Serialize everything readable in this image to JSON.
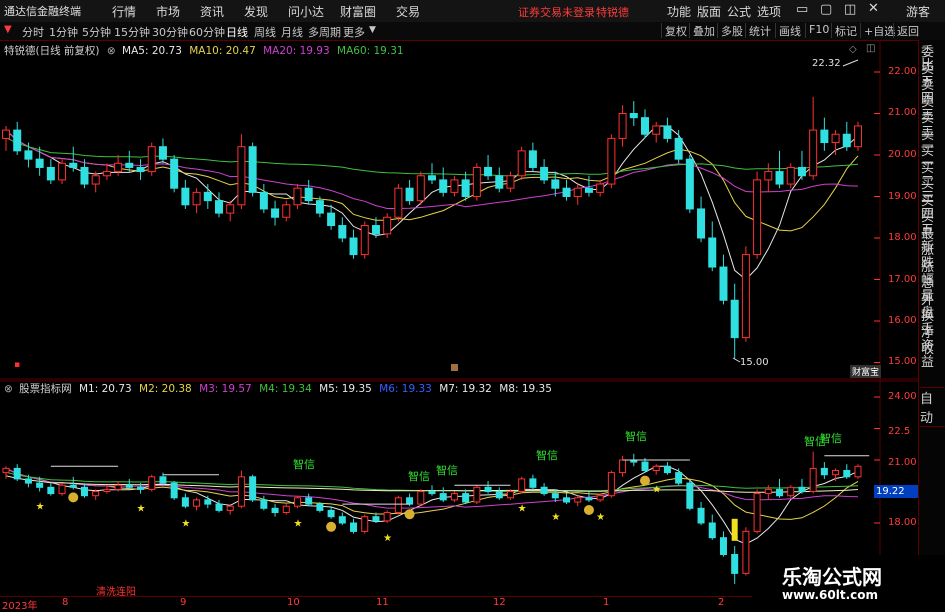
{
  "menubar": {
    "app_name": "通达信金融终端",
    "items": [
      "行情",
      "市场",
      "资讯",
      "发现",
      "问小达",
      "财富圈",
      "交易"
    ],
    "notice": "证券交易未登录",
    "stock_name": "特锐德",
    "right_items": [
      "功能",
      "版面",
      "公式",
      "选项"
    ],
    "user": "游客"
  },
  "toolbar": {
    "periods": [
      "分时",
      "1分钟",
      "5分钟",
      "15分钟",
      "30分钟",
      "60分钟",
      "日线",
      "周线",
      "月线",
      "多周期",
      "更多"
    ],
    "active_period": "日线",
    "buttons": [
      "复权",
      "叠加",
      "多股",
      "统计",
      "画线",
      "F10",
      "标记",
      "+自选",
      "返回"
    ]
  },
  "main_chart": {
    "header_name": "特锐德(日线 前复权)",
    "ma": [
      {
        "label": "MA5: 20.73",
        "color": "#e8e8e8"
      },
      {
        "label": "MA10: 20.47",
        "color": "#e6d34a"
      },
      {
        "label": "MA20: 19.93",
        "color": "#d040d0"
      },
      {
        "label": "MA60: 19.31",
        "color": "#40c040"
      }
    ],
    "y_ticks": [
      "22.00",
      "21.00",
      "20.00",
      "19.00",
      "18.00",
      "17.00",
      "16.00",
      "15.00"
    ],
    "high_label": "22.32",
    "low_label": "15.00",
    "corner_tag": "财富宝"
  },
  "indicator": {
    "name": "股票指标网",
    "lines": [
      {
        "label": "M1: 20.73",
        "color": "#e8e8e8"
      },
      {
        "label": "M2: 20.38",
        "color": "#e6d34a"
      },
      {
        "label": "M3: 19.57",
        "color": "#d040d0"
      },
      {
        "label": "M4: 19.34",
        "color": "#40c040"
      },
      {
        "label": "M5: 19.35",
        "color": "#e8e8e8"
      },
      {
        "label": "M6: 19.33",
        "color": "#3060ff"
      },
      {
        "label": "M7: 19.32",
        "color": "#e8e8e8"
      },
      {
        "label": "M8: 19.35",
        "color": "#e8e8e8"
      }
    ],
    "y_ticks": [
      "24.00",
      "22.5",
      "21.00",
      "19.22",
      "18.00"
    ],
    "current_value": "19.22",
    "signal_label": "智信",
    "bottom_note": "清洗连阳"
  },
  "time_axis": [
    "2023年",
    "8",
    "9",
    "10",
    "11",
    "12",
    "1",
    "2"
  ],
  "right_panel": [
    "委比",
    "卖五",
    "卖四",
    "卖三",
    "卖二",
    "卖一",
    "买一",
    "买二",
    "买三",
    "买四",
    "买五",
    "最新",
    "涨跌",
    "涨幅",
    "总量",
    "外盘",
    "换手",
    "净资",
    "收益"
  ],
  "right_panel_auto": "自动",
  "watermark": {
    "title": "乐淘公式网",
    "url": "www.60lt.com"
  },
  "colors": {
    "up": "#ff3030",
    "down": "#30e0e0",
    "grid": "#5a0000",
    "axis_text": "#ff3b3b"
  },
  "chart_data": {
    "type": "candlestick",
    "title": "特锐德(日线 前复权)",
    "ylim": [
      14.8,
      22.5
    ],
    "candles": [
      [
        20.4,
        20.7,
        20.1,
        20.6
      ],
      [
        20.6,
        20.8,
        20.0,
        20.1
      ],
      [
        20.1,
        20.3,
        19.7,
        19.9
      ],
      [
        19.9,
        20.2,
        19.5,
        19.7
      ],
      [
        19.7,
        19.9,
        19.3,
        19.4
      ],
      [
        19.4,
        19.9,
        19.3,
        19.8
      ],
      [
        19.8,
        20.2,
        19.6,
        19.7
      ],
      [
        19.7,
        19.9,
        19.2,
        19.3
      ],
      [
        19.3,
        19.6,
        19.1,
        19.5
      ],
      [
        19.5,
        19.8,
        19.4,
        19.6
      ],
      [
        19.6,
        20.0,
        19.5,
        19.8
      ],
      [
        19.8,
        20.1,
        19.6,
        19.7
      ],
      [
        19.7,
        19.9,
        19.4,
        19.6
      ],
      [
        19.6,
        20.3,
        19.5,
        20.2
      ],
      [
        20.2,
        20.4,
        19.8,
        19.9
      ],
      [
        19.9,
        20.0,
        19.1,
        19.2
      ],
      [
        19.2,
        19.4,
        18.7,
        18.8
      ],
      [
        18.8,
        19.2,
        18.6,
        19.1
      ],
      [
        19.1,
        19.3,
        18.7,
        18.9
      ],
      [
        18.9,
        19.1,
        18.5,
        18.6
      ],
      [
        18.6,
        18.9,
        18.4,
        18.8
      ],
      [
        18.8,
        20.5,
        18.7,
        20.2
      ],
      [
        20.2,
        20.3,
        19.0,
        19.1
      ],
      [
        19.1,
        19.3,
        18.6,
        18.7
      ],
      [
        18.7,
        18.9,
        18.3,
        18.5
      ],
      [
        18.5,
        18.9,
        18.4,
        18.8
      ],
      [
        18.8,
        19.3,
        18.7,
        19.2
      ],
      [
        19.2,
        19.4,
        18.8,
        18.9
      ],
      [
        18.9,
        19.0,
        18.5,
        18.6
      ],
      [
        18.6,
        18.8,
        18.2,
        18.3
      ],
      [
        18.3,
        18.5,
        17.9,
        18.0
      ],
      [
        18.0,
        18.2,
        17.5,
        17.6
      ],
      [
        17.6,
        18.4,
        17.5,
        18.3
      ],
      [
        18.3,
        18.5,
        18.0,
        18.1
      ],
      [
        18.1,
        18.6,
        18.0,
        18.5
      ],
      [
        18.5,
        19.3,
        18.4,
        19.2
      ],
      [
        19.2,
        19.4,
        18.8,
        18.9
      ],
      [
        18.9,
        19.6,
        18.8,
        19.5
      ],
      [
        19.5,
        19.8,
        19.3,
        19.4
      ],
      [
        19.4,
        19.7,
        19.0,
        19.1
      ],
      [
        19.1,
        19.5,
        19.0,
        19.4
      ],
      [
        19.4,
        19.6,
        18.9,
        19.0
      ],
      [
        19.0,
        19.8,
        18.9,
        19.7
      ],
      [
        19.7,
        20.0,
        19.4,
        19.5
      ],
      [
        19.5,
        19.7,
        19.1,
        19.2
      ],
      [
        19.2,
        19.6,
        19.1,
        19.5
      ],
      [
        19.5,
        20.2,
        19.4,
        20.1
      ],
      [
        20.1,
        20.3,
        19.6,
        19.7
      ],
      [
        19.7,
        19.9,
        19.3,
        19.4
      ],
      [
        19.4,
        19.6,
        19.0,
        19.2
      ],
      [
        19.2,
        19.4,
        18.9,
        19.0
      ],
      [
        19.0,
        19.3,
        18.8,
        19.2
      ],
      [
        19.2,
        19.5,
        19.0,
        19.1
      ],
      [
        19.1,
        19.4,
        19.0,
        19.3
      ],
      [
        19.3,
        20.5,
        19.2,
        20.4
      ],
      [
        20.4,
        21.2,
        20.2,
        21.0
      ],
      [
        21.0,
        21.3,
        20.7,
        20.9
      ],
      [
        20.9,
        21.1,
        20.4,
        20.5
      ],
      [
        20.5,
        20.8,
        20.3,
        20.7
      ],
      [
        20.7,
        20.9,
        20.3,
        20.4
      ],
      [
        20.4,
        20.6,
        19.8,
        19.9
      ],
      [
        19.9,
        20.0,
        18.6,
        18.7
      ],
      [
        18.7,
        19.0,
        17.9,
        18.0
      ],
      [
        18.0,
        18.4,
        17.2,
        17.3
      ],
      [
        17.3,
        17.6,
        16.4,
        16.5
      ],
      [
        16.5,
        16.9,
        15.1,
        15.6
      ],
      [
        15.6,
        17.8,
        15.5,
        17.6
      ],
      [
        17.6,
        19.6,
        17.5,
        19.4
      ],
      [
        19.4,
        19.8,
        19.1,
        19.6
      ],
      [
        19.6,
        20.1,
        19.2,
        19.3
      ],
      [
        19.3,
        19.8,
        19.2,
        19.7
      ],
      [
        19.7,
        20.1,
        19.4,
        19.5
      ],
      [
        19.5,
        21.4,
        19.4,
        20.6
      ],
      [
        20.6,
        20.9,
        20.1,
        20.3
      ],
      [
        20.3,
        20.6,
        20.0,
        20.5
      ],
      [
        20.5,
        20.8,
        20.1,
        20.2
      ],
      [
        20.2,
        20.8,
        20.1,
        20.7
      ]
    ]
  }
}
